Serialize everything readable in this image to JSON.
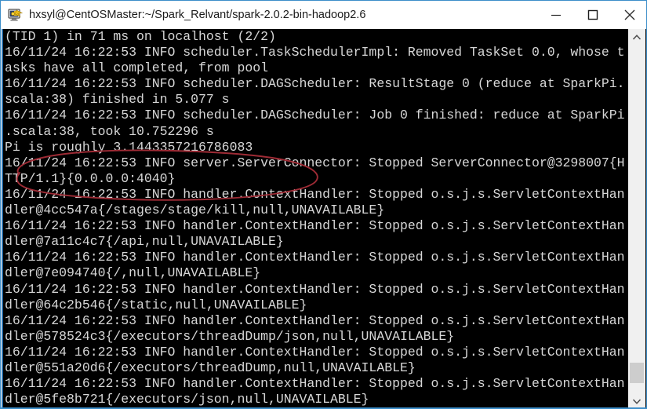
{
  "window": {
    "title": "hxsyl@CentOSMaster:~/Spark_Relvant/spark-2.0.2-bin-hadoop2.6",
    "icon": "putty-terminal-icon",
    "frame_color": "#3d8ec9",
    "titlebar_bg": "#ffffff",
    "controls": {
      "minimize_label": "Minimize",
      "maximize_label": "Maximize",
      "close_label": "Close"
    }
  },
  "terminal": {
    "background": "#000000",
    "foreground": "#d7d7d7",
    "lines": [
      "(TID 1) in 71 ms on localhost (2/2)",
      "16/11/24 16:22:53 INFO scheduler.TaskSchedulerImpl: Removed TaskSet 0.0, whose t",
      "asks have all completed, from pool",
      "16/11/24 16:22:53 INFO scheduler.DAGScheduler: ResultStage 0 (reduce at SparkPi.",
      "scala:38) finished in 5.077 s",
      "16/11/24 16:22:53 INFO scheduler.DAGScheduler: Job 0 finished: reduce at SparkPi",
      ".scala:38, took 10.752296 s",
      "Pi is roughly 3.1443357216786083",
      "16/11/24 16:22:53 INFO server.ServerConnector: Stopped ServerConnector@3298007{H",
      "TTP/1.1}{0.0.0.0:4040}",
      "16/11/24 16:22:53 INFO handler.ContextHandler: Stopped o.s.j.s.ServletContextHan",
      "dler@4cc547a{/stages/stage/kill,null,UNAVAILABLE}",
      "16/11/24 16:22:53 INFO handler.ContextHandler: Stopped o.s.j.s.ServletContextHan",
      "dler@7a11c4c7{/api,null,UNAVAILABLE}",
      "16/11/24 16:22:53 INFO handler.ContextHandler: Stopped o.s.j.s.ServletContextHan",
      "dler@7e094740{/,null,UNAVAILABLE}",
      "16/11/24 16:22:53 INFO handler.ContextHandler: Stopped o.s.j.s.ServletContextHan",
      "dler@64c2b546{/static,null,UNAVAILABLE}",
      "16/11/24 16:22:53 INFO handler.ContextHandler: Stopped o.s.j.s.ServletContextHan",
      "dler@578524c3{/executors/threadDump/json,null,UNAVAILABLE}",
      "16/11/24 16:22:53 INFO handler.ContextHandler: Stopped o.s.j.s.ServletContextHan",
      "dler@551a20d6{/executors/threadDump,null,UNAVAILABLE}",
      "16/11/24 16:22:53 INFO handler.ContextHandler: Stopped o.s.j.s.ServletContextHan",
      "dler@5fe8b721{/executors/json,null,UNAVAILABLE}"
    ]
  },
  "annotation": {
    "kind": "hand-drawn-ellipse",
    "color": "#9e2b35",
    "highlights_text": "Pi is roughly 3.1443357216786083"
  },
  "scrollbar": {
    "orientation": "vertical",
    "up_arrow": "chevron-up",
    "down_arrow": "chevron-down",
    "thumb_color": "#cdcdcd",
    "track_color": "#f0f0f0"
  }
}
